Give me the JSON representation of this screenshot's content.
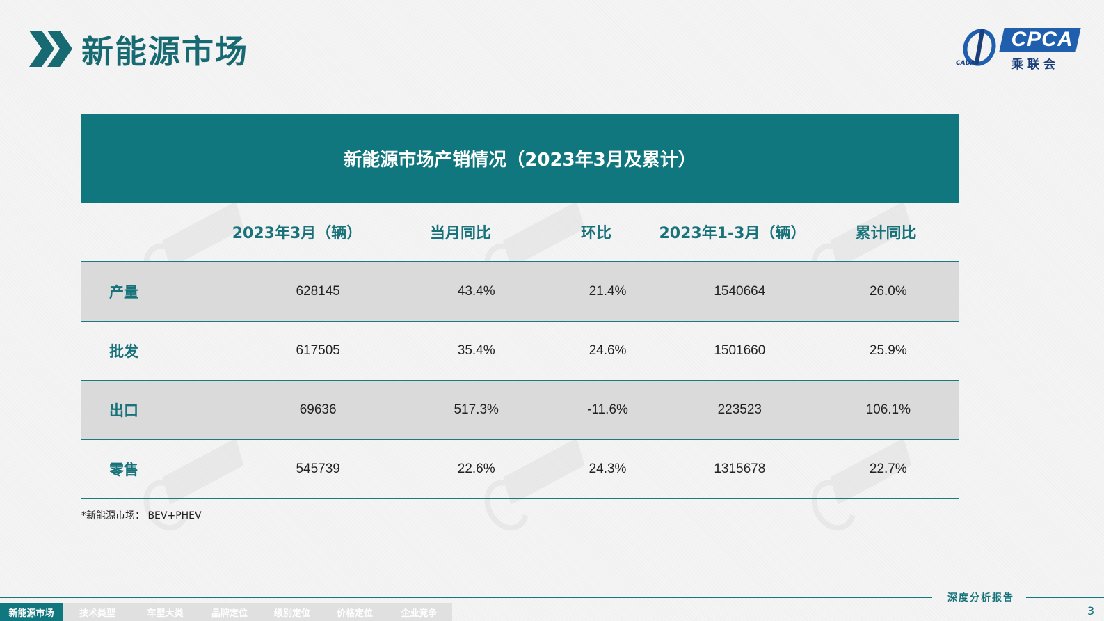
{
  "header": {
    "title": "新能源市场",
    "logo_text": "CPCA",
    "logo_cn": "乘联会",
    "logo_emblem_text": "CADA"
  },
  "table": {
    "title": "新能源市场产销情况（2023年3月及累计）",
    "columns": [
      "",
      "2023年3月（辆）",
      "当月同比",
      "环比",
      "2023年1-3月（辆）",
      "累计同比"
    ],
    "rows": [
      {
        "label": "产量",
        "values": [
          "628145",
          "43.4%",
          "21.4%",
          "1540664",
          "26.0%"
        ]
      },
      {
        "label": "批发",
        "values": [
          "617505",
          "35.4%",
          "24.6%",
          "1501660",
          "25.9%"
        ]
      },
      {
        "label": "出口",
        "values": [
          "69636",
          "517.3%",
          "-11.6%",
          "223523",
          "106.1%"
        ]
      },
      {
        "label": "零售",
        "values": [
          "545739",
          "22.6%",
          "24.3%",
          "1315678",
          "22.7%"
        ]
      }
    ]
  },
  "footnote": "*新能源市场：  BEV+PHEV",
  "footer": {
    "report_tag": "深度分析报告",
    "page_number": "3",
    "nav": [
      "新能源市场",
      "技术类型",
      "车型大类",
      "品牌定位",
      "级别定位",
      "价格定位",
      "企业竞争"
    ],
    "active_index": 0
  },
  "colors": {
    "accent": "#11777e",
    "heading_text": "#17727a",
    "shaded_row": "#dadada",
    "logo_blue": "#1f5fae"
  }
}
